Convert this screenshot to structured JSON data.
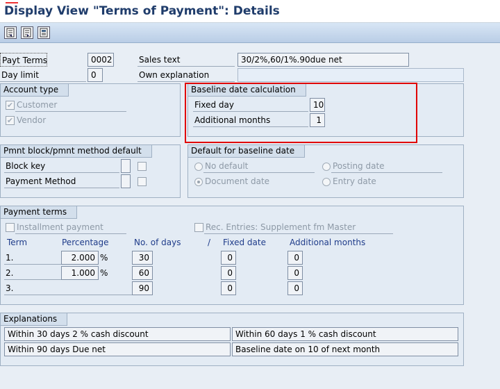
{
  "window": {
    "title": "Display View \"Terms of Payment\": Details"
  },
  "toolbar": {
    "buttons": [
      {
        "name": "previous-entry-icon"
      },
      {
        "name": "next-entry-icon"
      },
      {
        "name": "other-entry-icon"
      }
    ]
  },
  "header": {
    "payt_terms_label": "Payt Terms",
    "payt_terms_value": "0002",
    "sales_text_label": "Sales text",
    "sales_text_value": "30/2%,60/1%.90due net",
    "day_limit_label": "Day limit",
    "day_limit_value": "0",
    "own_explanation_label": "Own explanation",
    "own_explanation_value": ""
  },
  "account_type": {
    "title": "Account type",
    "customer_label": "Customer",
    "customer_checked": true,
    "vendor_label": "Vendor",
    "vendor_checked": true
  },
  "baseline_calc": {
    "title": "Baseline date calculation",
    "fixed_day_label": "Fixed day",
    "fixed_day_value": "10",
    "additional_months_label": "Additional months",
    "additional_months_value": "1"
  },
  "pmnt_block": {
    "title": "Pmnt block/pmnt method default",
    "block_key_label": "Block key",
    "payment_method_label": "Payment Method"
  },
  "default_baseline": {
    "title": "Default for baseline date",
    "no_default_label": "No default",
    "posting_date_label": "Posting date",
    "document_date_label": "Document date",
    "entry_date_label": "Entry date",
    "selected": "Document date"
  },
  "payment_terms": {
    "title": "Payment terms",
    "installment_label": "Installment payment",
    "rec_entries_label": "Rec. Entries: Supplement fm Master",
    "col_term": "Term",
    "col_percentage": "Percentage",
    "col_days": "No. of days",
    "col_slash": "/",
    "col_fixed_date": "Fixed date",
    "col_additional_months": "Additional months",
    "percent_sign": "%",
    "rows": [
      {
        "term": "1.",
        "percentage": "2.000",
        "days": "30",
        "fixed_date": "0",
        "additional_months": "0"
      },
      {
        "term": "2.",
        "percentage": "1.000",
        "days": "60",
        "fixed_date": "0",
        "additional_months": "0"
      },
      {
        "term": "3.",
        "percentage": "",
        "days": "90",
        "fixed_date": "0",
        "additional_months": "0"
      }
    ]
  },
  "explanations": {
    "title": "Explanations",
    "lines": [
      "Within 30 days 2 % cash discount",
      "Within 60 days 1 % cash discount",
      "Within 90 days Due net",
      "Baseline date on 10 of next month"
    ]
  },
  "colors": {
    "highlight": "#e00000",
    "title_text": "#1f3c6b"
  }
}
